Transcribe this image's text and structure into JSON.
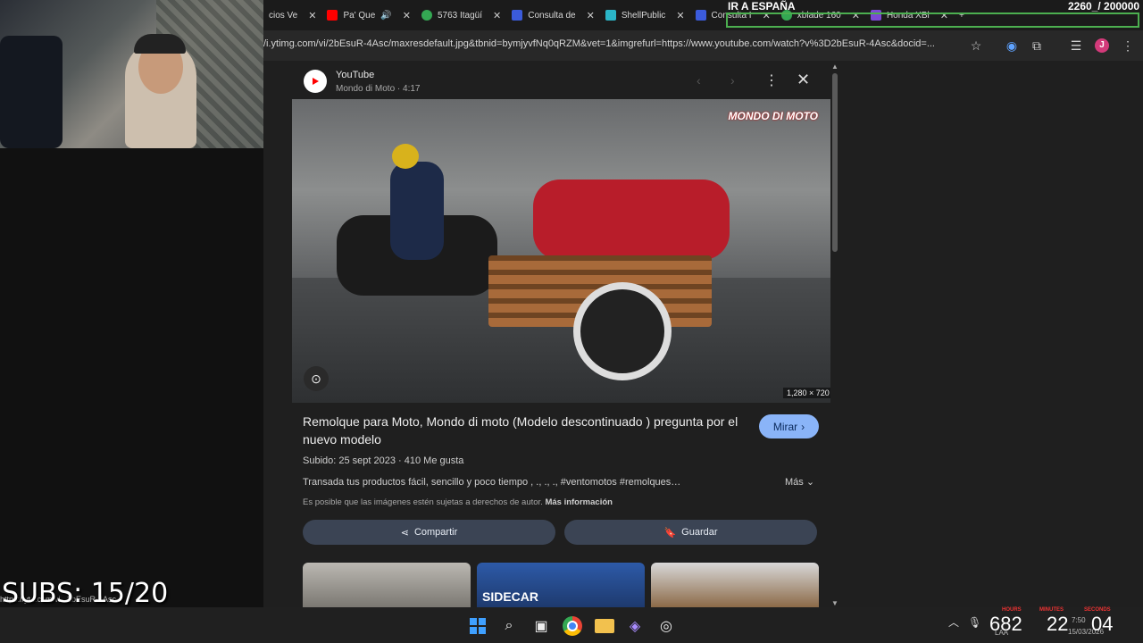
{
  "tabs": [
    {
      "label": "cios Ve",
      "color": "#8ab4f8"
    },
    {
      "label": "Pa' Que",
      "color": "#ff0000"
    },
    {
      "label": "5763 Itagüí",
      "color": "#34a853"
    },
    {
      "label": "Consulta de",
      "color": "#3b5bdb"
    },
    {
      "label": "ShellPublic",
      "color": "#2bb5c7"
    },
    {
      "label": "Consulta I",
      "color": "#3b5bdb"
    },
    {
      "label": "xblade 160",
      "color": "#34a853"
    },
    {
      "label": "Honda XBl",
      "color": "#7b4bd6"
    }
  ],
  "overlay": {
    "title": "IR A ESPAÑA",
    "counter": "2260_/ 200000"
  },
  "address_bar": {
    "url": "/i.ytimg.com/vi/2bEsuR-4Asc/maxresdefault.jpg&tbnid=bymjyvfNq0qRZM&vet=1&imgrefurl=https://www.youtube.com/watch?v%3D2bEsuR-4Asc&docid=...",
    "profile_initial": "J"
  },
  "panel": {
    "source_name": "YouTube",
    "source_meta": "Mondo di Moto · 4:17",
    "image_watermark": "MONDO DI MOTO",
    "image_dims": "1,280 × 720",
    "title": "Remolque para Moto, Mondo di moto (Modelo descontinuado ) pregunta por el nuevo modelo",
    "visit_label": "Mirar",
    "meta": "Subido: 25 sept 2023 · 410 Me gusta",
    "description": "Transada tus productos fácil, sencillo y poco tiempo , ., ., ., #ventomotos #remolques…",
    "more_label": "Más",
    "copyright_text": "Es posible que las imágenes estén sujetas a derechos de autor.",
    "copyright_link": "Más información",
    "share_label": "Compartir",
    "save_label": "Guardar",
    "thumb2_label": "SIDECAR"
  },
  "stream": {
    "subs": "SUBS: 15/20",
    "status_link": "https://yt...com/vi...2bEsuR-4Asc"
  },
  "timer": {
    "hours": "682",
    "minutes": "22",
    "seconds": "04",
    "hours_label": "HOURS",
    "minutes_label": "MINUTES",
    "seconds_label": "SECONDS"
  },
  "clock": {
    "time": "7:50",
    "date": "15/03/2026",
    "lang": "LAA"
  }
}
